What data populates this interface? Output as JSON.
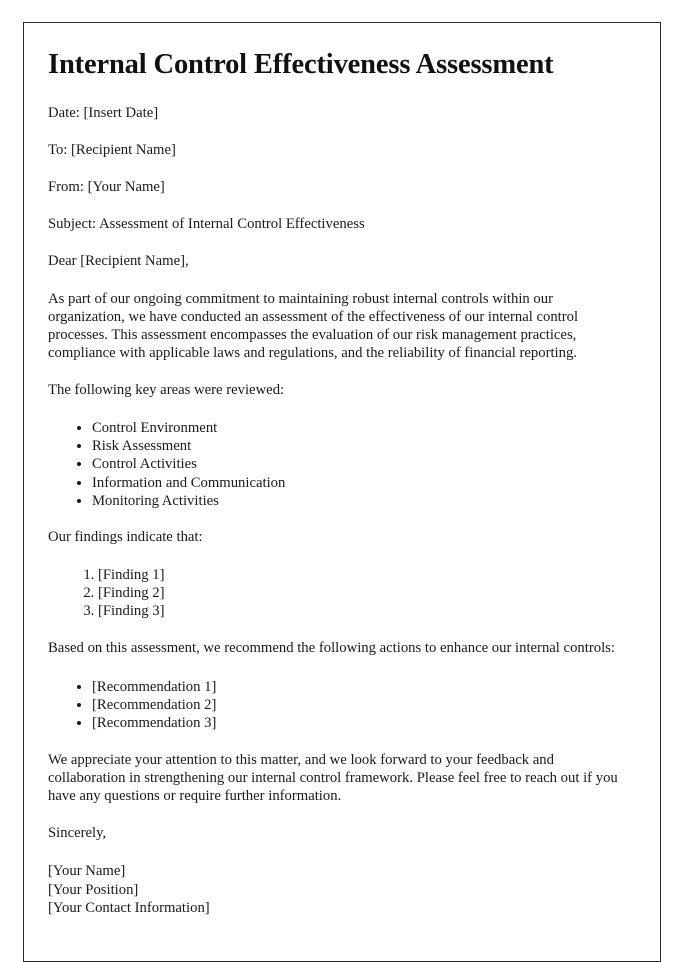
{
  "document": {
    "title": "Internal Control Effectiveness Assessment",
    "header_fields": {
      "date": "Date: [Insert Date]",
      "to": "To: [Recipient Name]",
      "from": "From: [Your Name]",
      "subject": "Subject: Assessment of Internal Control Effectiveness"
    },
    "salutation": "Dear [Recipient Name],",
    "intro_paragraph": "As part of our ongoing commitment to maintaining robust internal controls within our organization, we have conducted an assessment of the effectiveness of our internal control processes. This assessment encompasses the evaluation of our risk management practices, compliance with applicable laws and regulations, and the reliability of financial reporting.",
    "key_areas_lead_in": "The following key areas were reviewed:",
    "key_areas": [
      "Control Environment",
      "Risk Assessment",
      "Control Activities",
      "Information and Communication",
      "Monitoring Activities"
    ],
    "findings_lead_in": "Our findings indicate that:",
    "findings": [
      "[Finding 1]",
      "[Finding 2]",
      "[Finding 3]"
    ],
    "recommendations_lead_in": "Based on this assessment, we recommend the following actions to enhance our internal controls:",
    "recommendations": [
      "[Recommendation 1]",
      "[Recommendation 2]",
      "[Recommendation 3]"
    ],
    "closing_paragraph": "We appreciate your attention to this matter, and we look forward to your feedback and collaboration in strengthening our internal control framework. Please feel free to reach out if you have any questions or require further information.",
    "sign_off": "Sincerely,",
    "signature_block": [
      "[Your Name]",
      "[Your Position]",
      "[Your Contact Information]"
    ]
  },
  "style": {
    "page_border_color": "#2b2b2b",
    "text_color": "#1a1a1a",
    "page_background": "#ffffff"
  }
}
